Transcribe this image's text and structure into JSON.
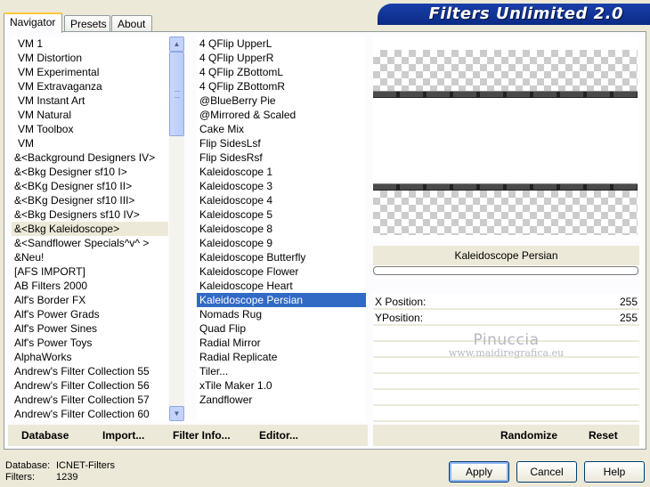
{
  "tabs": [
    {
      "label": "Navigator",
      "active": true
    },
    {
      "label": "Presets",
      "active": false
    },
    {
      "label": "About",
      "active": false
    }
  ],
  "banner": {
    "title": "Filters Unlimited 2.0"
  },
  "categories": [
    "VM 1",
    "VM Distortion",
    "VM Experimental",
    "VM Extravaganza",
    "VM Instant Art",
    "VM Natural",
    "VM Toolbox",
    "VM",
    "&<Background Designers IV>",
    "&<Bkg Designer sf10 I>",
    "&<BKg Designer sf10 II>",
    "&<BKg Designer sf10 III>",
    "&<Bkg Designers sf10 IV>",
    "&<Bkg Kaleidoscope>",
    "&<Sandflower Specials^v^ >",
    "&Neu!",
    "[AFS IMPORT]",
    "AB Filters 2000",
    "Alf's Border FX",
    "Alf's Power Grads",
    "Alf's Power Sines",
    "Alf's Power Toys",
    "AlphaWorks",
    "Andrew's Filter Collection 55",
    "Andrew's Filter Collection 56",
    "Andrew's Filter Collection 57",
    "Andrew's Filter Collection 60"
  ],
  "selected_category": "&<Bkg Kaleidoscope>",
  "filters": [
    "4 QFlip UpperL",
    "4 QFlip UpperR",
    "4 QFlip ZBottomL",
    "4 QFlip ZBottomR",
    "@BlueBerry Pie",
    "@Mirrored & Scaled",
    "Cake Mix",
    "Flip SidesLsf",
    "Flip SidesRsf",
    "Kaleidoscope 1",
    "Kaleidoscope 3",
    "Kaleidoscope 4",
    "Kaleidoscope 5",
    "Kaleidoscope 8",
    "Kaleidoscope 9",
    "Kaleidoscope Butterfly",
    "Kaleidoscope Flower",
    "Kaleidoscope Heart",
    "Kaleidoscope Persian",
    "Nomads Rug",
    "Quad Flip",
    "Radial Mirror",
    "Radial Replicate",
    "Tiler...",
    "xTile Maker 1.0",
    "Zandflower"
  ],
  "selected_filter": "Kaleidoscope Persian",
  "preview": {
    "filter_name": "Kaleidoscope Persian"
  },
  "params": [
    {
      "label": "X Position:",
      "value": "255"
    },
    {
      "label": "YPosition:",
      "value": "255"
    }
  ],
  "watermark": {
    "line1": "Pinuccia",
    "line2": "www.maidiregrafica.eu"
  },
  "left_buttons": {
    "database": "Database",
    "import": "Import...",
    "filter_info": "Filter Info...",
    "editor": "Editor..."
  },
  "right_buttons": {
    "randomize": "Randomize",
    "reset": "Reset"
  },
  "status": {
    "database_label": "Database:",
    "database_value": "ICNET-Filters",
    "filters_label": "Filters:",
    "filters_value": "1239"
  },
  "dialog_buttons": {
    "apply": "Apply",
    "cancel": "Cancel",
    "help": "Help"
  },
  "colors": {
    "selection": "#316ac5",
    "banner": "#0a2a86",
    "dialog_bg": "#ece9d8"
  }
}
